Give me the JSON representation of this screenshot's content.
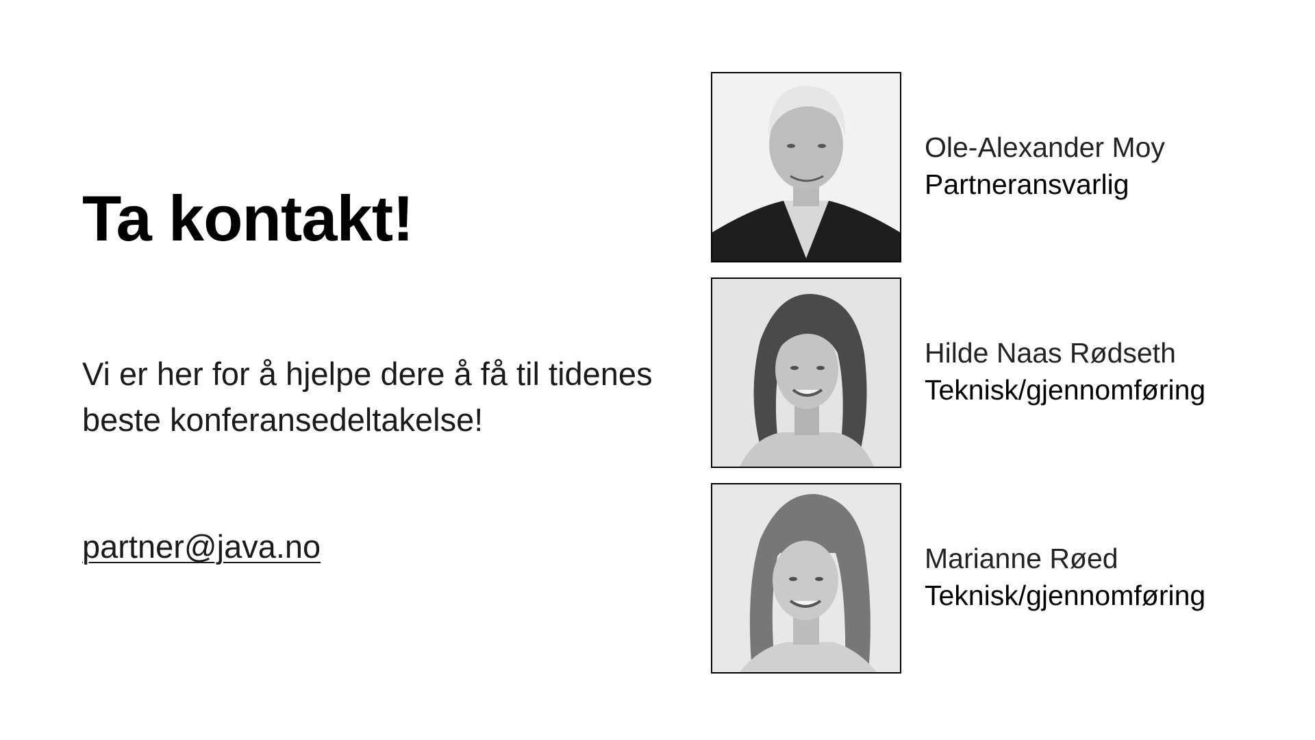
{
  "slide": {
    "title": "Ta kontakt!",
    "tagline": "Vi er her for å hjelpe dere å få til tidenes beste konferansedeltakelse!",
    "email": "partner@java.no"
  },
  "contacts": [
    {
      "name": "Ole-Alexander Moy",
      "role": "Partneransvarlig"
    },
    {
      "name": "Hilde Naas Rødseth",
      "role": "Teknisk/gjennomføring"
    },
    {
      "name": "Marianne Røed",
      "role": "Teknisk/gjennomføring"
    }
  ],
  "colors": {
    "background": "#ffffff",
    "text": "#000000",
    "photo_border": "#000000"
  }
}
